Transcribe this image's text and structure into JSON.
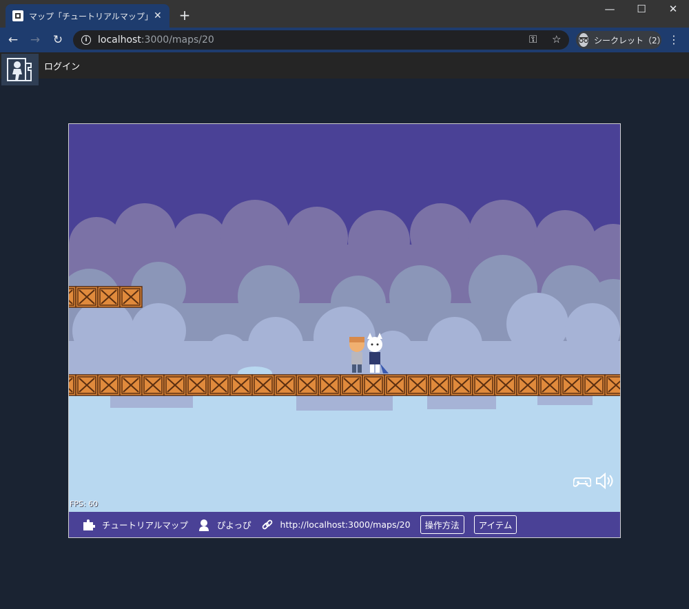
{
  "browser": {
    "tab_title": "マップ「チュートリアルマップ」 - みんなで",
    "new_tab": "+",
    "window_controls": {
      "minimize": "—",
      "maximize": "☐",
      "close": "✕"
    },
    "url_host": "localhost",
    "url_path": ":3000/maps/20",
    "profile_label": "シークレット（2）",
    "icons": [
      "back-icon",
      "forward-icon",
      "reload-icon",
      "info-icon",
      "key-icon",
      "star-icon",
      "incognito-icon",
      "menu-icon"
    ]
  },
  "site": {
    "login_label": "ログイン"
  },
  "game": {
    "fps_text": "FPS: 60",
    "sky_color": "#4a4196",
    "ground_color": "#b8d8f0",
    "crate_color": "#e08a3c"
  },
  "footer": {
    "map_name": "チュートリアルマップ",
    "author": "ぴよっぴ",
    "url": "http://localhost:3000/maps/20",
    "controls_button": "操作方法",
    "items_button": "アイテム"
  }
}
